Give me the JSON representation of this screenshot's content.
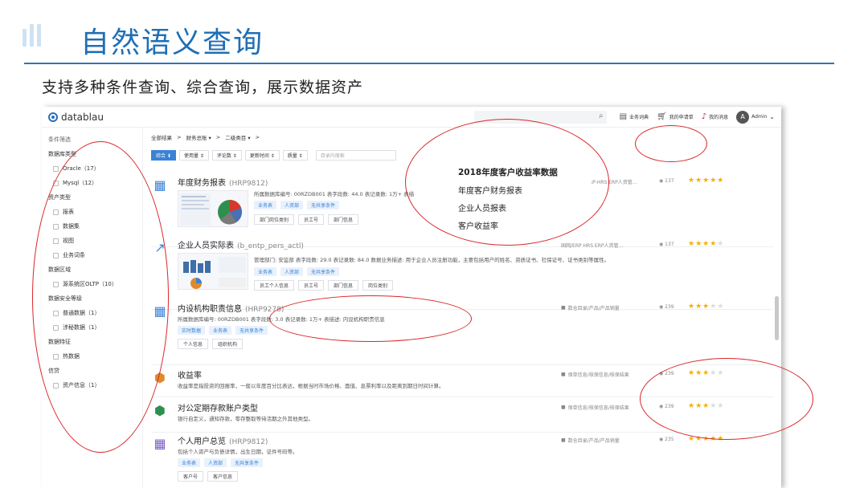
{
  "slide": {
    "title": "自然语义查询",
    "subtitle": "支持多种条件查询、综合查询，展示数据资产"
  },
  "app": {
    "logo": "datablau",
    "topnav": [
      {
        "icon": "book-icon",
        "label": "业务词典"
      },
      {
        "icon": "cart-icon",
        "label": "我的申请单"
      },
      {
        "icon": "bell-icon",
        "label": "我的消息"
      }
    ],
    "user": {
      "avatar_letter": "A",
      "name": "Admin"
    }
  },
  "sidebar": {
    "filter_title": "条件筛选",
    "groups": [
      {
        "title": "数据库类型",
        "options": [
          "Oracle（17）",
          "Mysql（12）"
        ]
      },
      {
        "title": "资产类型",
        "options": [
          "报表",
          "数据集",
          "视图",
          "业务词条"
        ]
      },
      {
        "title": "数据区域",
        "options": [
          "源系统区OLTP（10）"
        ]
      },
      {
        "title": "数据安全等级",
        "options": [
          "普通数据（1）",
          "涉秘数据（1）"
        ]
      },
      {
        "title": "数据特征",
        "options": [
          "热数据"
        ]
      },
      {
        "title": "信贷",
        "options": [
          "资产信息（1）"
        ]
      }
    ]
  },
  "breadcrumb": [
    "全部结果",
    "财务总账 ▾",
    "二级类目 ▾"
  ],
  "filters": {
    "buttons": [
      "综合 ⬇",
      "使用量 ⇕",
      "评论数 ⇕",
      "更新时间 ⇕",
      "质量 ⇕"
    ],
    "search_placeholder": "目录内搜索"
  },
  "dropdown": {
    "items": [
      "2018年度客户收益率数据",
      "年度客户财务报表",
      "企业人员报表",
      "客户收益率"
    ]
  },
  "assets": [
    {
      "title": "年度财务报表",
      "code": "(HRP9812)",
      "meta": "所属数据库编号: 00RZDB001  表字段数: 44.0  表记录数: 1万+  表描",
      "tags": [
        "业务表",
        "人资部",
        "无共享条件"
      ],
      "tags2": [
        "部门岗位类别",
        "员工号",
        "部门信息"
      ],
      "right": "RP-HRS ERP人资管...",
      "views": "137",
      "rating": 5
    },
    {
      "title": "企业人员实际表",
      "code": "(b_entp_pers_actl)",
      "meta": "管理部门: 安监部  表字段数: 29.0  表记录数: 84.0  数据业务描述: 用于企业人员注册功能，主要包括用户的姓名、资质证书、社保证号、证书类别等属性。",
      "tags": [
        "业务表",
        "人资部",
        "无共享条件"
      ],
      "tags2": [
        "员工个人信息",
        "员工号",
        "部门信息",
        "岗位类别"
      ],
      "right": "国网/ERP HRS ERP人资管...",
      "views": "137",
      "rating": 4
    },
    {
      "title": "内设机构职责信息",
      "code": "(HRP9278)",
      "meta": "所属数据库编号: 00RZDB001  表字段数: 3.0  表记录数: 1万+  表描述: 内设机构职责信息",
      "tags": [
        "实时数据",
        "业务表",
        "无共享条件"
      ],
      "tags2": [
        "个人信息",
        "组织机构"
      ],
      "right": "数仓目录/产品/产品销量",
      "views": "239",
      "rating": 3
    },
    {
      "title": "收益率",
      "desc": "收益率是指投资的回报率，一般以年度百分比表达，根据当时市场价格、面值、息票利率以及距离到期日时间计算。",
      "right": "保单信息/核保信息/核保结果",
      "views": "239",
      "rating": 3
    },
    {
      "title": "对公定期存款账户类型",
      "desc": "银行自定义，通知存款，零存整取等待活期之外其他类型。",
      "right": "保单信息/核保信息/核保结果",
      "views": "239",
      "rating": 3
    },
    {
      "title": "个人用户总览",
      "code": "(HRP9812)",
      "desc": "包括个人资产与负债详情，出生日期，证件号码等。",
      "tags": [
        "业务表",
        "人资部",
        "无共享条件"
      ],
      "tags2": [
        "客户号",
        "客户信息"
      ],
      "right": "数仓目录/产品/产品销量",
      "views": "235",
      "rating": 5
    }
  ],
  "colors": {
    "title_blue": "#1f6fb5",
    "accent": "#3b82d6",
    "star": "#f5b000",
    "annotation_red": "#d9262b"
  }
}
